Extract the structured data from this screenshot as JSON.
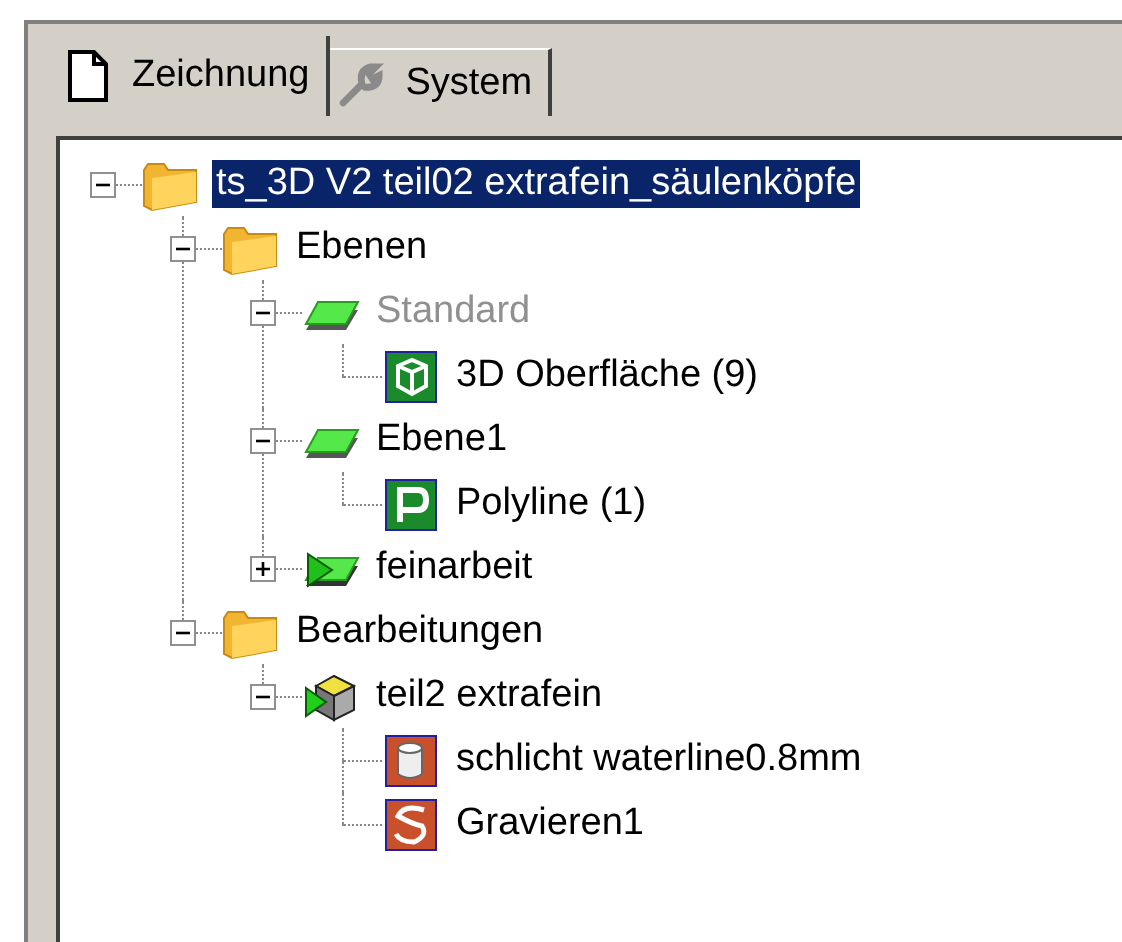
{
  "tabs": [
    {
      "label": "Zeichnung",
      "kind": "page",
      "selected": true
    },
    {
      "label": "System",
      "kind": "wrench",
      "selected": false
    }
  ],
  "tree": [
    {
      "label": "ts_3D V2 teil02 extrafein_säulenköpfe",
      "kind": "folder",
      "selected": true,
      "expanded": true,
      "dimmed": false,
      "children": [
        {
          "label": "Ebenen",
          "kind": "folder",
          "selected": false,
          "expanded": true,
          "dimmed": false,
          "children": [
            {
              "label": "Standard",
              "kind": "layer",
              "selected": false,
              "expanded": true,
              "dimmed": true,
              "children": [
                {
                  "label": "3D Oberfläche (9)",
                  "kind": "surface",
                  "selected": false,
                  "dimmed": false
                }
              ]
            },
            {
              "label": "Ebene1",
              "kind": "layer",
              "selected": false,
              "expanded": true,
              "dimmed": false,
              "children": [
                {
                  "label": "Polyline (1)",
                  "kind": "polyline",
                  "selected": false,
                  "dimmed": false
                }
              ]
            },
            {
              "label": "feinarbeit",
              "kind": "active-layer",
              "selected": false,
              "expanded": false,
              "dimmed": false
            }
          ]
        },
        {
          "label": "Bearbeitungen",
          "kind": "folder",
          "selected": false,
          "expanded": true,
          "dimmed": false,
          "children": [
            {
              "label": "teil2 extrafein",
              "kind": "operation",
              "selected": false,
              "expanded": true,
              "dimmed": false,
              "children": [
                {
                  "label": "schlicht waterline0.8mm",
                  "kind": "finishing",
                  "selected": false,
                  "dimmed": false
                },
                {
                  "label": "Gravieren1",
                  "kind": "engraving",
                  "selected": false,
                  "dimmed": false
                }
              ]
            }
          ]
        }
      ]
    }
  ]
}
